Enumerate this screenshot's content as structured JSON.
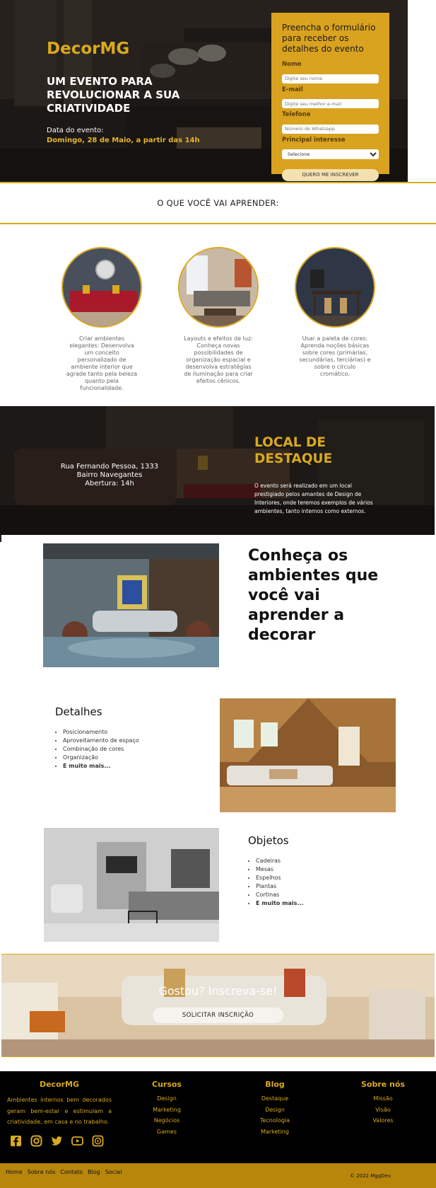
{
  "hero": {
    "brand": "DecorMG",
    "headline": "UM EVENTO PARA REVOLUCIONAR A SUA CRIATIVIDADE",
    "date_label": "Data do evento:",
    "date_value": "Domingo, 28 de Maio, a partir das 14h"
  },
  "form": {
    "title": "Preencha o formulário para receber os detalhes do evento",
    "name_label": "Nome",
    "name_placeholder": "Digite seu nome",
    "email_label": "E-mail",
    "email_placeholder": "Digite seu melhor e-mail",
    "phone_label": "Telefone",
    "phone_placeholder": "Número de Whatsapp",
    "interest_label": "Principal interesse",
    "interest_selected": "Selecione",
    "submit_label": "QUERO ME INSCREVER"
  },
  "learn": {
    "heading": "O QUE VOCÊ VAI APRENDER:",
    "cards": [
      {
        "text": "Criar ambientes elegantes: Desenvolva um conceito personalizado de ambiente interior que agrade tanto pela beleza quanto pela funcionalidade."
      },
      {
        "text": "Layouts e efeitos de luz: Conheça novas possibilidades de organização espacial e desenvolva estratégias de iluminação para criar efeitos cênicos."
      },
      {
        "text": "Usar a paleta de cores: Aprenda noções básicas sobre cores (primárias, secundárias, terciárias) e sobre o círculo cromático."
      }
    ]
  },
  "local": {
    "address_line1": "Rua Fernando Pessoa, 1333",
    "address_line2": "Bairro Navegantes",
    "address_line3": "Abertura: 14h",
    "title": "LOCAL DE DESTAQUE",
    "description": "O evento será realizado em um local prestigiado pelos amantes de Design de Interiores, onde teremos exemplos de vários ambientes, tanto internos como externos."
  },
  "ambientes": {
    "title": "Conheça os ambientes que você vai aprender a decorar"
  },
  "details": {
    "title": "Detalhes",
    "items": [
      "Posicionamento",
      "Aproveitamento de espaço",
      "Combinação de cores",
      "Organização"
    ],
    "more": "E muito mais..."
  },
  "objects": {
    "title": "Objetos",
    "items": [
      "Cadeiras",
      "Mesas",
      "Espelhos",
      "Plantas",
      "Cortinas"
    ],
    "more": "E muito mais..."
  },
  "cta": {
    "question": "Gostou? Inscreva-se!",
    "button": "SOLICITAR INSCRIÇÃO"
  },
  "footer": {
    "about_title": "DecorMG",
    "about_text": "Ambientes internos bem decorados geram bem-estar e estimulam a criatividade, em casa e no trabalho.",
    "cols": [
      {
        "title": "Cursos",
        "links": [
          "Design",
          "Marketing",
          "Negócios",
          "Games"
        ]
      },
      {
        "title": "Blog",
        "links": [
          "Destaque",
          "Design",
          "Tecnologia",
          "Marketing"
        ]
      },
      {
        "title": "Sobre nós",
        "links": [
          "Missão",
          "Visão",
          "Valores"
        ]
      }
    ],
    "socials": [
      "facebook-icon",
      "instagram-icon",
      "twitter-icon",
      "youtube-icon",
      "whatsapp-icon"
    ],
    "bottom_links": [
      "Home",
      "Sobre nós",
      "Contato",
      "Blog",
      "Social"
    ],
    "copyright": "© 2022 MggDev"
  },
  "colors": {
    "accent": "#d9a91f",
    "footer_bg": "#000000",
    "bottom_bar": "#b8860b"
  }
}
